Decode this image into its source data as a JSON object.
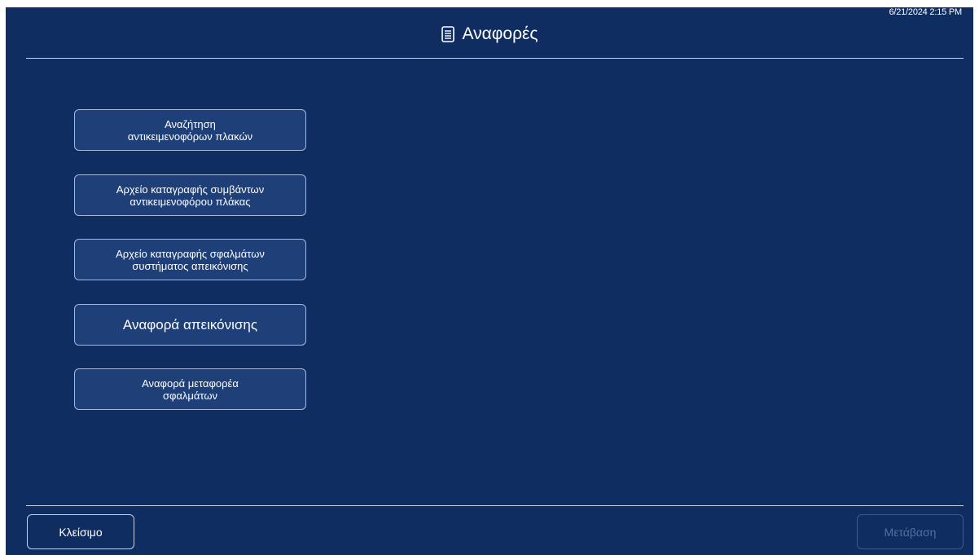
{
  "header": {
    "timestamp": "6/21/2024 2:15 PM",
    "title": "Αναφορές",
    "title_icon": "report-document-icon"
  },
  "menu": {
    "items": [
      {
        "label": "Αναζήτηση\nαντικειμενοφόρων πλακών"
      },
      {
        "label": "Αρχείο καταγραφής συμβάντων\nαντικειμενοφόρου πλάκας"
      },
      {
        "label": "Αρχείο καταγραφής σφαλμάτων\nσυστήματος απεικόνισης"
      },
      {
        "label": "Αναφορά απεικόνισης"
      },
      {
        "label": "Αναφορά μεταφορέα\nσφαλμάτων"
      }
    ]
  },
  "footer": {
    "close_label": "Κλείσιμο",
    "go_label": "Μετάβαση",
    "go_state": "disabled"
  },
  "colors": {
    "background": "#0f2d61",
    "button_fill": "#1e3f78",
    "button_border": "#a8b8d6",
    "text": "#ffffff",
    "disabled_text": "#55709e"
  }
}
